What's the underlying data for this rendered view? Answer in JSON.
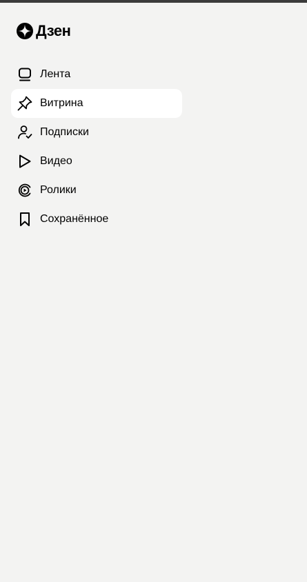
{
  "app": {
    "logo_text": "Дзен",
    "logo_icon": "dzen-star-icon"
  },
  "sidebar": {
    "items": [
      {
        "label": "Лента",
        "icon": "feed-icon",
        "active": false
      },
      {
        "label": "Витрина",
        "icon": "pin-icon",
        "active": true
      },
      {
        "label": "Подписки",
        "icon": "subscriptions-icon",
        "active": false
      },
      {
        "label": "Видео",
        "icon": "play-icon",
        "active": false
      },
      {
        "label": "Ролики",
        "icon": "shorts-icon",
        "active": false
      },
      {
        "label": "Сохранённое",
        "icon": "bookmark-icon",
        "active": false
      }
    ]
  },
  "colors": {
    "background": "#f3f3f2",
    "active_item_bg": "#ffffff",
    "text": "#000000",
    "top_bar": "#3b3b3b"
  }
}
